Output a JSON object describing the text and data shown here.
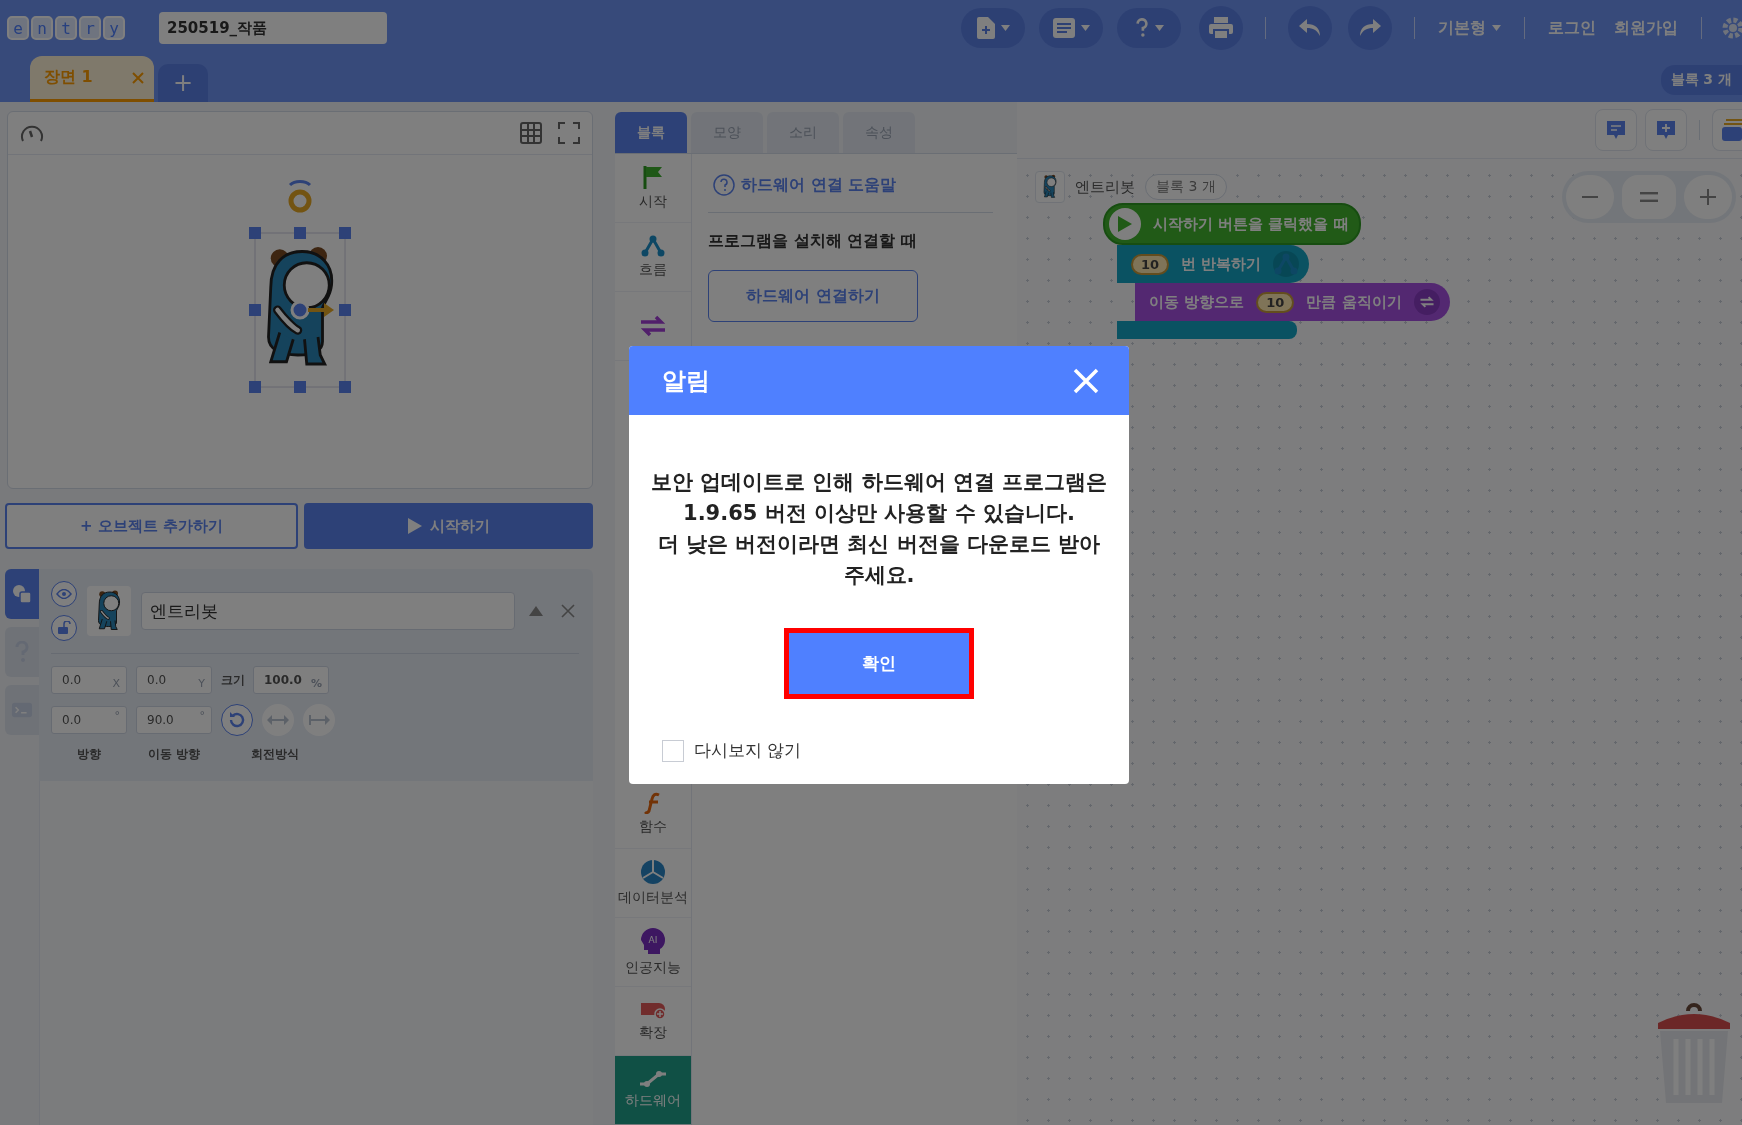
{
  "header": {
    "logo": [
      "e",
      "n",
      "t",
      "r",
      "y"
    ],
    "project_title": "250519_작품",
    "mode_menu": "기본형",
    "login": "로그인",
    "signup": "회원가입"
  },
  "scenes": [
    {
      "label": "장면 1",
      "selected": true
    }
  ],
  "add_scene": "+",
  "block_count_badge": "블록 3 개",
  "stage_buttons": {
    "add_object": "+ 오브젝트 추가하기",
    "start": "시작하기"
  },
  "object_side_tabs": [
    {
      "kind": "object",
      "selected": true
    },
    {
      "kind": "help",
      "selected": false
    },
    {
      "kind": "console",
      "selected": false
    }
  ],
  "object": {
    "name": "엔트리봇",
    "x": {
      "value": "0.0",
      "unit": "X"
    },
    "y": {
      "value": "0.0",
      "unit": "Y"
    },
    "size_label": "크기",
    "size": {
      "value": "100.0",
      "unit": "%"
    },
    "direction": {
      "value": "0.0",
      "unit": "°"
    },
    "move_direction": {
      "value": "90.0",
      "unit": "°"
    },
    "rotation_modes": [
      {
        "kind": "free",
        "selected": true
      },
      {
        "kind": "horizontal",
        "selected": false
      },
      {
        "kind": "none",
        "selected": false
      }
    ],
    "labels": [
      "방향",
      "이동 방향",
      "회전방식"
    ]
  },
  "block_tabs": [
    {
      "label": "블록",
      "selected": true
    },
    {
      "label": "모양",
      "selected": false
    },
    {
      "label": "소리",
      "selected": false
    },
    {
      "label": "속성",
      "selected": false
    }
  ],
  "categories_top": [
    {
      "kind": "start",
      "label": "시작",
      "selected": false
    },
    {
      "kind": "flow",
      "label": "흐름",
      "selected": false
    },
    {
      "kind": "moving",
      "selected": false
    }
  ],
  "categories_bottom": [
    {
      "kind": "func",
      "label": "함수",
      "selected": false
    },
    {
      "kind": "analysis",
      "label": "데이터분석",
      "selected": false
    },
    {
      "kind": "ai",
      "label": "인공지능",
      "icon_text": "AI",
      "selected": false
    },
    {
      "kind": "expansion",
      "label": "확장",
      "selected": false
    },
    {
      "kind": "hardware",
      "label": "하드웨어",
      "selected": true
    }
  ],
  "block_menu": {
    "help_link": "하드웨어 연결 도움말",
    "section_title": "프로그램을 설치해 연결할 때",
    "connect_button": "하드웨어 연결하기"
  },
  "workspace": {
    "object_name": "엔트리봇",
    "block_count": "블록 3 개",
    "blocks": [
      {
        "kind": "event",
        "text": "시작하기 버튼을 클릭했을 때"
      },
      {
        "kind": "repeat",
        "value": "10",
        "text": "번 반복하기"
      },
      {
        "kind": "move",
        "prefix": "이동 방향으로",
        "value": "10",
        "text": "만큼 움직이기"
      }
    ]
  },
  "dialog": {
    "title": "알림",
    "message_lines": [
      "보안 업데이트로 인해 하드웨어 연결 프로그램은",
      "1.9.65 버전 이상만 사용할 수 있습니다.",
      "더 낮은 버전이라면 최신 버전을 다운로드 받아",
      "주세요."
    ],
    "confirm": "확인",
    "dont_show_again": {
      "label": "다시보지 않기",
      "checked": false
    }
  }
}
